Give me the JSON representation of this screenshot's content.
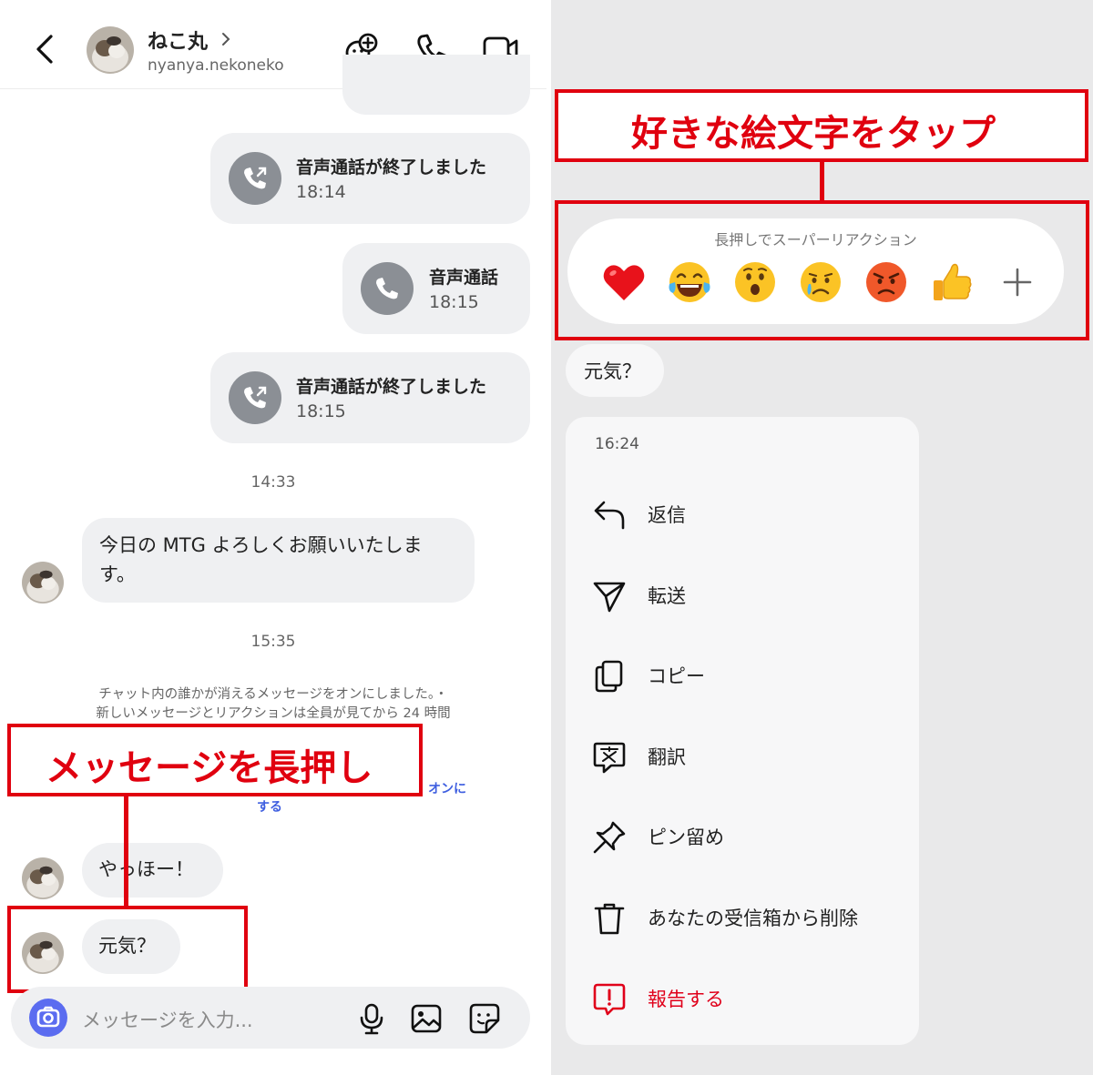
{
  "header": {
    "name": "ねこ丸",
    "username": "nyanya.nekoneko"
  },
  "messages": {
    "call1": {
      "title": "音声通話が終了しました",
      "time": "18:14"
    },
    "call2": {
      "title": "音声通話",
      "time": "18:15"
    },
    "call3": {
      "title": "音声通話が終了しました",
      "time": "18:15"
    },
    "ts1": "14:33",
    "msg1_line1": "今日の MTG よろしくお願いいたしま",
    "msg1_line2": "す。",
    "ts2": "15:35",
    "system_line1": "チャット内の誰かが消えるメッセージをオンにしました。・",
    "system_line2": "新しいメッセージとリアクションは全員が見てから 24 時間",
    "system_link1": "オンに",
    "system_link2": "する",
    "msg2": "やっほー！",
    "msg3": "元気？"
  },
  "annotations": {
    "left_callout": "メッセージを長押し",
    "right_callout": "好きな絵文字をタップ"
  },
  "input": {
    "placeholder": "メッセージを入力..."
  },
  "reaction_bar": {
    "hint": "長押しでスーパーリアクション",
    "emojis": [
      "heart-emoji",
      "laughing-tears-emoji",
      "surprised-emoji",
      "crying-emoji",
      "angry-emoji",
      "thumbs-up-emoji",
      "plus-icon"
    ]
  },
  "selected_message": "元気？",
  "context_menu": {
    "time": "16:24",
    "items": [
      {
        "label": "返信",
        "icon": "reply-icon"
      },
      {
        "label": "転送",
        "icon": "forward-icon"
      },
      {
        "label": "コピー",
        "icon": "copy-icon"
      },
      {
        "label": "翻訳",
        "icon": "translate-icon"
      },
      {
        "label": "ピン留め",
        "icon": "pin-icon"
      },
      {
        "label": "あなたの受信箱から削除",
        "icon": "trash-icon"
      },
      {
        "label": "報告する",
        "icon": "report-icon"
      }
    ]
  },
  "colors": {
    "accent_red": "#e0000f",
    "camera_blue": "#5b6cf0",
    "link_blue": "#3f5fe0",
    "bubble_gray": "#eff0f2"
  }
}
